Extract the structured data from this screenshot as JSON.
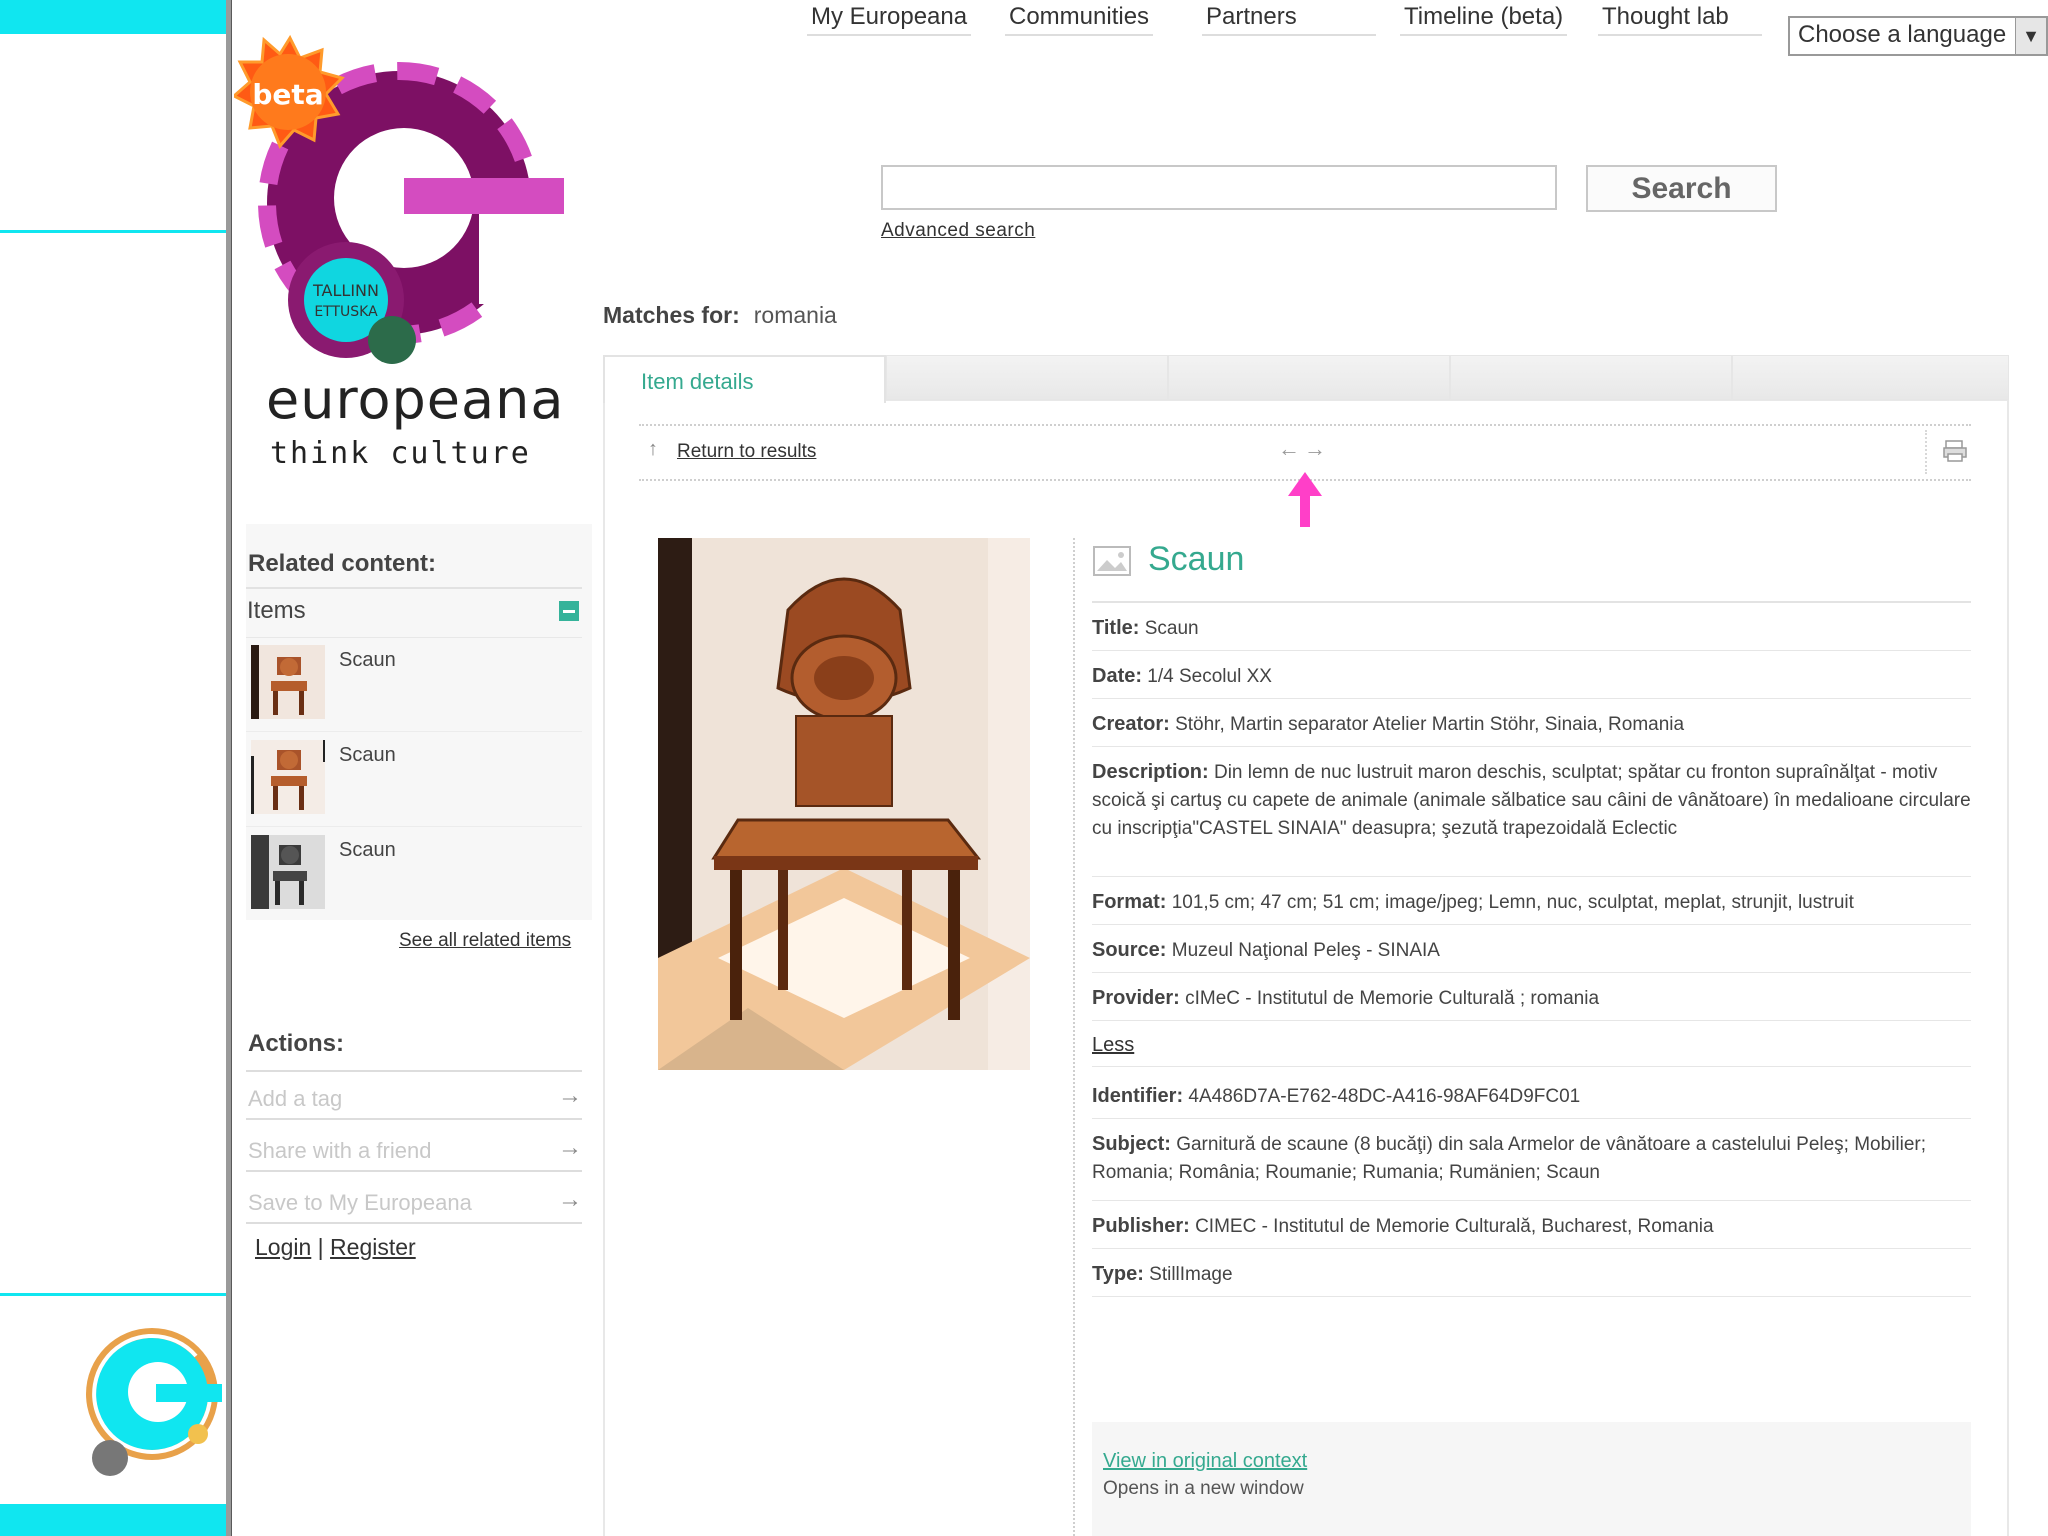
{
  "nav": {
    "items": [
      "My Europeana",
      "Communities",
      "Partners",
      "Timeline (beta)",
      "Thought lab"
    ],
    "language_select": "Choose a language"
  },
  "logo": {
    "badge": "beta",
    "wordmark": "europeana",
    "tagline": "think culture"
  },
  "search": {
    "value": "",
    "button_label": "Search",
    "advanced_label": "Advanced search"
  },
  "matches": {
    "label": "Matches for:",
    "query": "romania"
  },
  "sidebar": {
    "related_title": "Related content:",
    "items_label": "Items",
    "related_items": [
      {
        "label": "Scaun"
      },
      {
        "label": "Scaun"
      },
      {
        "label": "Scaun"
      }
    ],
    "see_all": "See all related items",
    "actions_title": "Actions:",
    "actions": [
      {
        "label": "Add a tag"
      },
      {
        "label": "Share with a friend"
      },
      {
        "label": "Save to My Europeana"
      }
    ],
    "login": "Login",
    "separator": "|",
    "register": "Register"
  },
  "main": {
    "active_tab": "Item details",
    "return_label": "Return to results",
    "prev_glyph": "←",
    "next_glyph": "→",
    "item_title": "Scaun",
    "fields": [
      {
        "label": "Title:",
        "value": "Scaun"
      },
      {
        "label": "Date:",
        "value": "1/4 Secolul XX"
      },
      {
        "label": "Creator:",
        "value": "Stöhr, Martin separator Atelier Martin Stöhr, Sinaia, Romania"
      },
      {
        "label": "Description:",
        "value": "Din lemn de nuc lustruit maron deschis, sculptat; spătar cu fronton supraînălţat - motiv scoică şi cartuş cu capete de animale (animale sălbatice sau câini de vânătoare) în medalioane circulare cu inscripţia\"CASTEL SINAIA\" deasupra; şezută trapezoidală Eclectic"
      },
      {
        "label": "Format:",
        "value": "101,5 cm;  47 cm;  51 cm;  image/jpeg;  Lemn, nuc, sculptat, meplat, strunjit, lustruit"
      },
      {
        "label": "Source:",
        "value": "Muzeul Naţional Peleş - SINAIA"
      },
      {
        "label": "Provider:",
        "value": "cIMeC - Institutul de Memorie Culturală ;  romania"
      }
    ],
    "less_label": "Less",
    "extra_fields": [
      {
        "label": "Identifier:",
        "value": "4A486D7A-E762-48DC-A416-98AF64D9FC01"
      },
      {
        "label": "Subject:",
        "value": "Garnitură de scaune (8 bucăţi) din sala Armelor de vânătoare a castelului Peleş;  Mobilier;  Romania;  România;  Roumanie;  Rumania;  Rumänien;  Scaun"
      },
      {
        "label": "Publisher:",
        "value": "CIMEC - Institutul de Memorie Culturală, Bucharest, Romania"
      },
      {
        "label": "Type:",
        "value": "StillImage"
      }
    ],
    "context_link": "View in original context",
    "context_note": "Opens in a new window"
  },
  "colors": {
    "accent": "#35a98f",
    "cyan": "#10e6f0",
    "pink_arrow": "#ff3fc8"
  }
}
